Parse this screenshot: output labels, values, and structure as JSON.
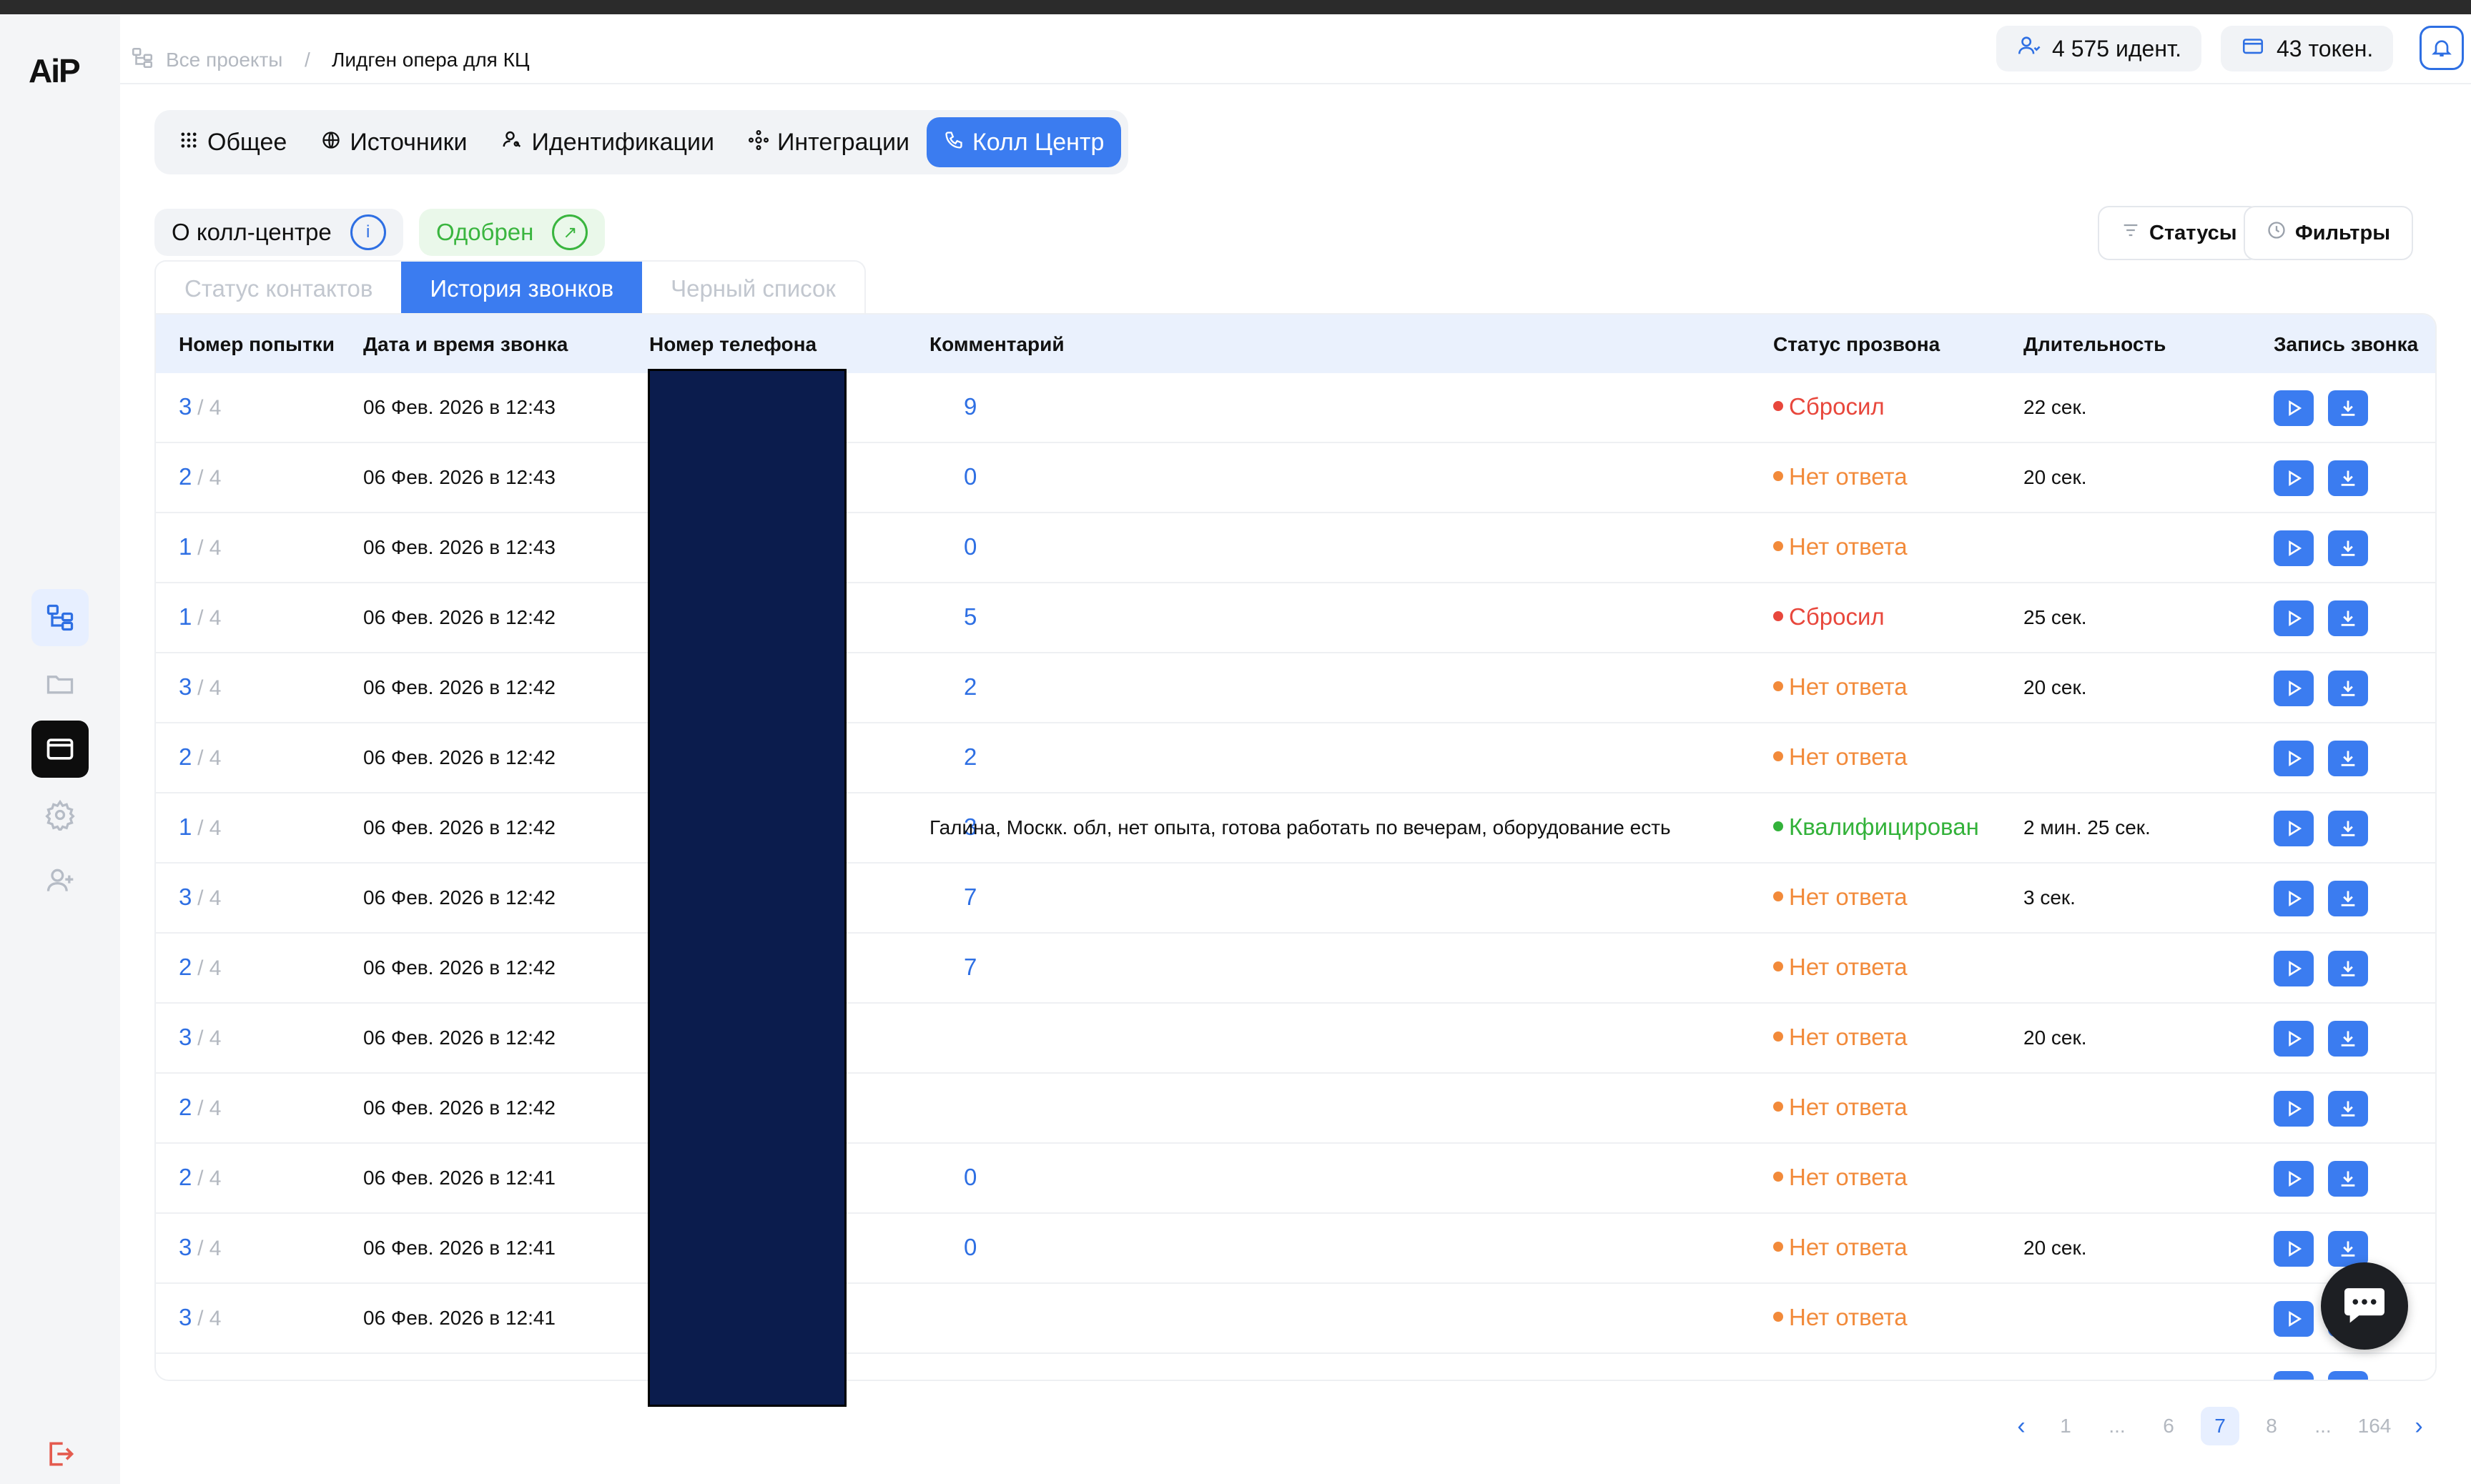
{
  "sidebar": {
    "logo": "AiP",
    "icons": [
      "projects-icon",
      "folder-icon",
      "window-icon",
      "settings-icon",
      "add-user-icon",
      "logout-icon"
    ]
  },
  "header": {
    "breadcrumb_all": "Все проекты",
    "breadcrumb_sep": "/",
    "breadcrumb_current": "Лидген опера для КЦ",
    "identifications": "4 575 идент.",
    "tokens": "43 токен."
  },
  "tabs": [
    {
      "label": "Общее",
      "icon": "grid-icon"
    },
    {
      "label": "Источники",
      "icon": "globe-icon"
    },
    {
      "label": "Идентификации",
      "icon": "user-search-icon"
    },
    {
      "label": "Интеграции",
      "icon": "integration-icon"
    },
    {
      "label": "Колл Центр",
      "icon": "phone-icon",
      "active": true
    }
  ],
  "subbar": {
    "about_label": "О колл-центре",
    "approved_label": "Одобрен",
    "statuses_label": "Статусы",
    "filters_label": "Фильтры"
  },
  "inner_tabs": [
    {
      "label": "Статус контактов"
    },
    {
      "label": "История звонков",
      "active": true
    },
    {
      "label": "Черный список"
    }
  ],
  "table": {
    "headers": [
      "Номер попытки",
      "Дата и время звонка",
      "Номер телефона",
      "Комментарий",
      "Статус прозвона",
      "Длительность",
      "Запись звонка"
    ],
    "rows": [
      {
        "attempt": "3",
        "total": "/ 4",
        "datetime": "06 Фев. 2026 в 12:43",
        "phone_tail": "9",
        "comment": "",
        "status": "Сбросил",
        "status_type": "red",
        "duration": "22 сек."
      },
      {
        "attempt": "2",
        "total": "/ 4",
        "datetime": "06 Фев. 2026 в 12:43",
        "phone_tail": "0",
        "comment": "",
        "status": "Нет ответа",
        "status_type": "orange",
        "duration": "20 сек."
      },
      {
        "attempt": "1",
        "total": "/ 4",
        "datetime": "06 Фев. 2026 в 12:43",
        "phone_tail": "0",
        "comment": "",
        "status": "Нет ответа",
        "status_type": "orange",
        "duration": ""
      },
      {
        "attempt": "1",
        "total": "/ 4",
        "datetime": "06 Фев. 2026 в 12:42",
        "phone_tail": "5",
        "comment": "",
        "status": "Сбросил",
        "status_type": "red",
        "duration": "25 сек."
      },
      {
        "attempt": "3",
        "total": "/ 4",
        "datetime": "06 Фев. 2026 в 12:42",
        "phone_tail": "2",
        "comment": "",
        "status": "Нет ответа",
        "status_type": "orange",
        "duration": "20 сек."
      },
      {
        "attempt": "2",
        "total": "/ 4",
        "datetime": "06 Фев. 2026 в 12:42",
        "phone_tail": "2",
        "comment": "",
        "status": "Нет ответа",
        "status_type": "orange",
        "duration": ""
      },
      {
        "attempt": "1",
        "total": "/ 4",
        "datetime": "06 Фев. 2026 в 12:42",
        "phone_tail": "3",
        "comment": "Галина, Москк. обл, нет опыта, готова работать по вечерам, оборудование есть",
        "status": "Квалифицирован",
        "status_type": "green",
        "duration": "2 мин. 25 сек."
      },
      {
        "attempt": "3",
        "total": "/ 4",
        "datetime": "06 Фев. 2026 в 12:42",
        "phone_tail": "7",
        "comment": "",
        "status": "Нет ответа",
        "status_type": "orange",
        "duration": "3 сек."
      },
      {
        "attempt": "2",
        "total": "/ 4",
        "datetime": "06 Фев. 2026 в 12:42",
        "phone_tail": "7",
        "comment": "",
        "status": "Нет ответа",
        "status_type": "orange",
        "duration": ""
      },
      {
        "attempt": "3",
        "total": "/ 4",
        "datetime": "06 Фев. 2026 в 12:42",
        "phone_tail": "",
        "comment": "",
        "status": "Нет ответа",
        "status_type": "orange",
        "duration": "20 сек."
      },
      {
        "attempt": "2",
        "total": "/ 4",
        "datetime": "06 Фев. 2026 в 12:42",
        "phone_tail": "",
        "comment": "",
        "status": "Нет ответа",
        "status_type": "orange",
        "duration": ""
      },
      {
        "attempt": "2",
        "total": "/ 4",
        "datetime": "06 Фев. 2026 в 12:41",
        "phone_tail": "0",
        "comment": "",
        "status": "Нет ответа",
        "status_type": "orange",
        "duration": ""
      },
      {
        "attempt": "3",
        "total": "/ 4",
        "datetime": "06 Фев. 2026 в 12:41",
        "phone_tail": "0",
        "comment": "",
        "status": "Нет ответа",
        "status_type": "orange",
        "duration": "20 сек."
      },
      {
        "attempt": "3",
        "total": "/ 4",
        "datetime": "06 Фев. 2026 в 12:41",
        "phone_tail": "",
        "comment": "",
        "status": "Нет ответа",
        "status_type": "orange",
        "duration": ""
      }
    ]
  },
  "pagination": {
    "pages": [
      "1",
      "...",
      "6",
      "7",
      "8",
      "...",
      "164"
    ],
    "current": "7",
    "prev": "‹",
    "next": "›"
  },
  "colors": {
    "accent": "#3b7cf0",
    "red": "#e8473c",
    "orange": "#f28a3a",
    "green": "#33b23a"
  }
}
